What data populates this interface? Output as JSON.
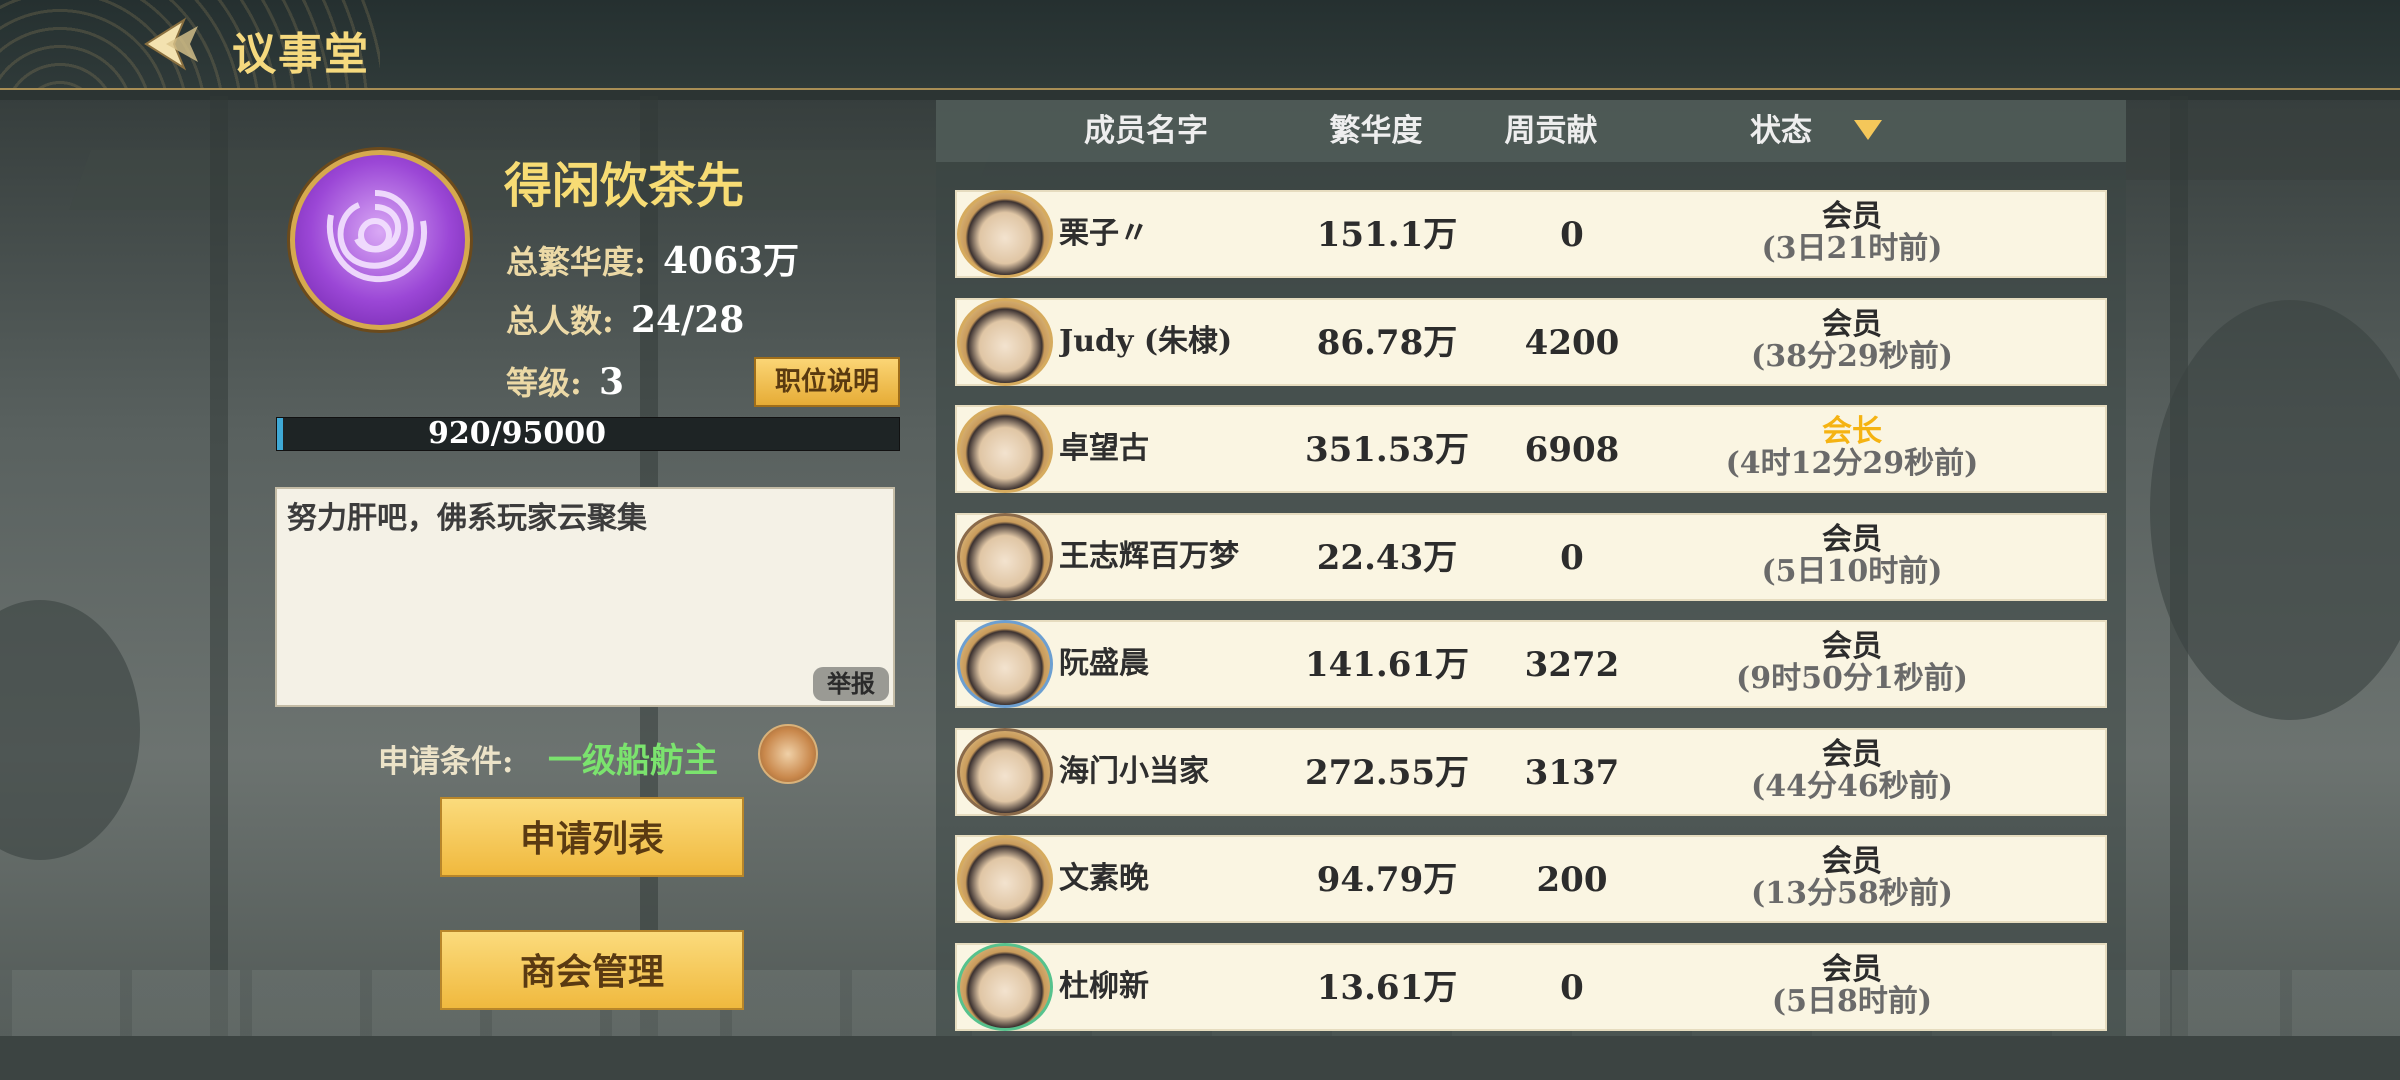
{
  "header": {
    "title": "议事堂"
  },
  "guild": {
    "name": "得闲饮茶先",
    "prosperity_label": "总繁华度:",
    "prosperity_value": "4063万",
    "members_label": "总人数:",
    "members_value": "24/28",
    "level_label": "等级:",
    "level_value": "3",
    "role_button": "职位说明",
    "exp_text": "920/95000",
    "exp_progress": 0.0097,
    "notice": "努力肝吧，佛系玩家云聚集",
    "report_button": "举报",
    "condition_label": "申请条件:",
    "condition_value": "一级船舫主",
    "apply_list_button": "申请列表",
    "manage_button": "商会管理"
  },
  "table": {
    "headers": [
      "成员名字",
      "繁华度",
      "周贡献",
      "状态"
    ],
    "members": [
      {
        "name": "栗子〃",
        "prosperity": "151.1万",
        "contribution": "0",
        "role": "会员",
        "last_online": "(3日21时前)"
      },
      {
        "name": "Judy (朱棣)",
        "prosperity": "86.78万",
        "contribution": "4200",
        "role": "会员",
        "last_online": "(38分29秒前)"
      },
      {
        "name": "卓望古",
        "prosperity": "351.53万",
        "contribution": "6908",
        "role": "会长",
        "last_online": "(4时12分29秒前)"
      },
      {
        "name": "王志辉百万梦",
        "prosperity": "22.43万",
        "contribution": "0",
        "role": "会员",
        "last_online": "(5日10时前)"
      },
      {
        "name": "阮盛晨",
        "prosperity": "141.61万",
        "contribution": "3272",
        "role": "会员",
        "last_online": "(9时50分1秒前)"
      },
      {
        "name": "海门小当家",
        "prosperity": "272.55万",
        "contribution": "3137",
        "role": "会员",
        "last_online": "(44分46秒前)"
      },
      {
        "name": "文素晚",
        "prosperity": "94.79万",
        "contribution": "200",
        "role": "会员",
        "last_online": "(13分58秒前)"
      },
      {
        "name": "杜柳新",
        "prosperity": "13.61万",
        "contribution": "0",
        "role": "会员",
        "last_online": "(5日8时前)"
      }
    ]
  },
  "colors": {
    "leader_role": "#f5b312",
    "accent_gold": "#f7dc74",
    "condition_green": "#7be36e"
  },
  "icons": {
    "back": "back-arrow-icon",
    "emblem": "rose-emblem-icon",
    "sort": "sort-down-icon",
    "condition": "bowl-icon"
  }
}
